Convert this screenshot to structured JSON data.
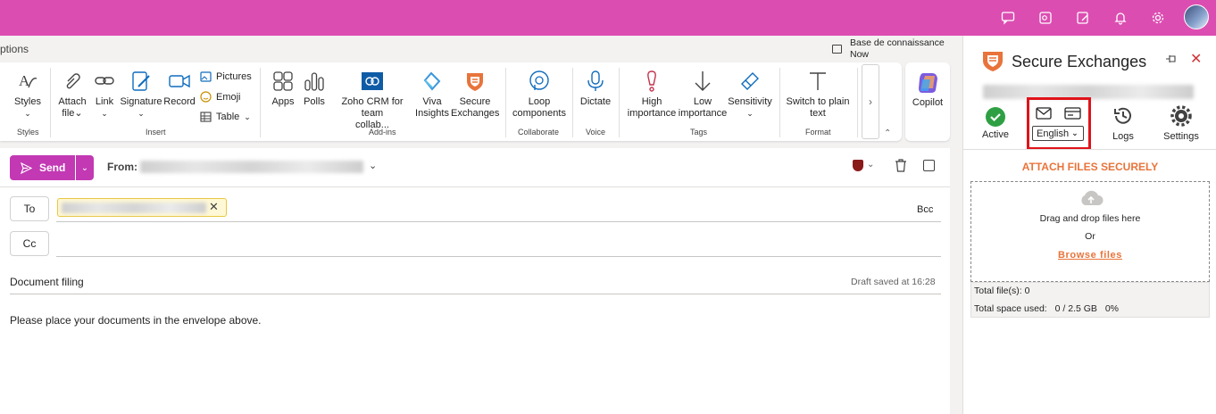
{
  "ribbon": {
    "options_label": "ptions",
    "knowledge_base_line1": "Base de connaissance",
    "knowledge_base_line2": "Now",
    "styles": {
      "label": "Styles",
      "group": "Styles"
    },
    "attach_line1": "Attach",
    "attach_line2": "file",
    "link": "Link",
    "signature": "Signature",
    "record": "Record",
    "pictures": "Pictures",
    "emoji": "Emoji",
    "table": "Table",
    "insert_group": "Insert",
    "apps": "Apps",
    "polls": "Polls",
    "zoho_line1": "Zoho CRM for team",
    "zoho_line2": "collab...",
    "viva_line1": "Viva",
    "viva_line2": "Insights",
    "secure_line1": "Secure",
    "secure_line2": "Exchanges",
    "addins_group": "Add-ins",
    "loop_line1": "Loop",
    "loop_line2": "components",
    "collaborate_group": "Collaborate",
    "dictate": "Dictate",
    "voice_group": "Voice",
    "high_line1": "High",
    "high_line2": "importance",
    "low_line1": "Low",
    "low_line2": "importance",
    "sensitivity": "Sensitivity",
    "tags_group": "Tags",
    "plain_line1": "Switch to plain",
    "plain_line2": "text",
    "format_group": "Format",
    "copilot": "Copilot"
  },
  "compose": {
    "send_label": "Send",
    "from_label": "From:",
    "to_label": "To",
    "cc_label": "Cc",
    "bcc_label": "Bcc",
    "subject": "Document filing",
    "draft_status": "Draft saved at 16:28",
    "body": "Please place your documents in the envelope above."
  },
  "pane": {
    "title": "Secure Exchanges",
    "active_label": "Active",
    "language": "English",
    "logs_label": "Logs",
    "settings_label": "Settings",
    "attach_title": "ATTACH FILES SECURELY",
    "drag_text": "Drag and drop files here",
    "or_text": "Or",
    "browse_text": "Browse files",
    "total_files": "Total file(s): 0",
    "total_space_label": "Total space used:",
    "total_space_value": "0 / 2.5 GB",
    "total_space_pct": "0%"
  },
  "colors": {
    "topbar": "#dc4db1",
    "send": "#c239b3",
    "accent_orange": "#e8743b",
    "highlight_red": "#e0131a",
    "active_green": "#2ea043"
  }
}
